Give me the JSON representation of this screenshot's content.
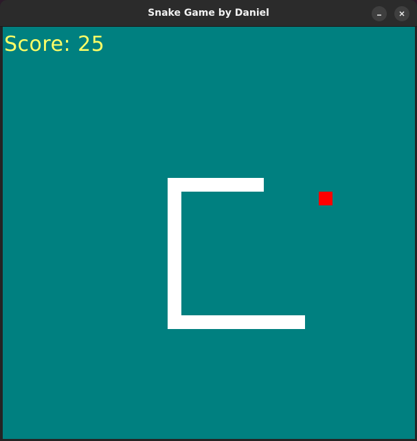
{
  "window": {
    "title": "Snake Game by Daniel"
  },
  "hud": {
    "score_text": "Score: 25"
  },
  "colors": {
    "background": "#008080",
    "snake": "#ffffff",
    "food": "#ff0000",
    "score_text": "#ffff66"
  },
  "controls": {
    "minimize_icon": "minimize-icon",
    "close_icon": "close-icon"
  }
}
